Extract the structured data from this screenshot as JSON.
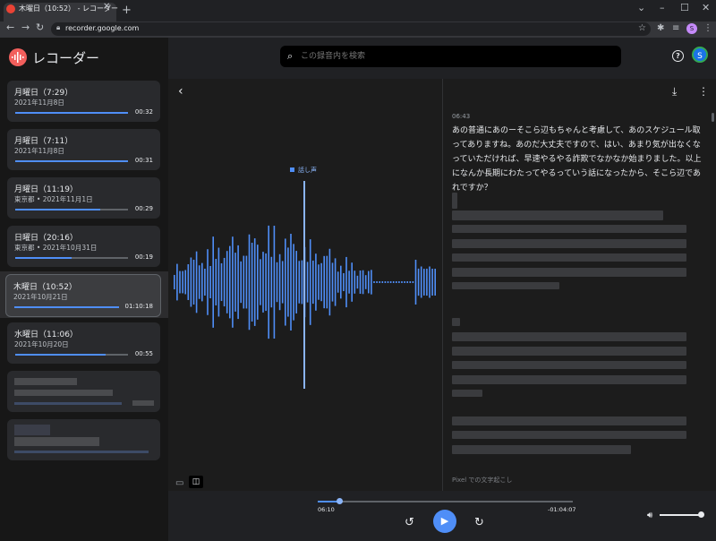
{
  "browser": {
    "tab_title": "木曜日（10:52） - レコーダー",
    "url": "recorder.google.com",
    "profile_initial": "S"
  },
  "app": {
    "title": "レコーダー",
    "search_placeholder": "この録音内を検索",
    "avatar_initial": "S",
    "accent_color": "#4f8ef7",
    "logo_color": "#f25f5c"
  },
  "recordings": [
    {
      "title": "月曜日（7:29）",
      "subtitle": "2021年11月8日",
      "duration": "00:32",
      "progress": 1.0
    },
    {
      "title": "月曜日（7:11）",
      "subtitle": "2021年11月8日",
      "duration": "00:31",
      "progress": 1.0
    },
    {
      "title": "月曜日（11:19）",
      "subtitle": "東京都 • 2021年11月1日",
      "duration": "00:29",
      "progress": 0.75
    },
    {
      "title": "日曜日（20:16）",
      "subtitle": "東京都 • 2021年10月31日",
      "duration": "00:19",
      "progress": 0.5
    },
    {
      "title": "木曜日（10:52）",
      "subtitle": "2021年10月21日",
      "duration": "01:10:18",
      "progress": 1.0,
      "selected": true
    },
    {
      "title": "水曜日（11:06）",
      "subtitle": "2021年10月20日",
      "duration": "00:55",
      "progress": 0.8
    }
  ],
  "waveform": {
    "marker_label": "話し声"
  },
  "transcript": {
    "timestamp": "06:43",
    "text": "あの普通にあのーそこら辺もちゃんと考慮して、あのスケジュール取ってありますね。あのだ大丈夫ですので、はい、あまり気が出なくなっていただければ、早速やるやる詐欺でなかなか始まりました。以上になんか長期にわたってやるっていう話になったから、そこら辺であれですか？",
    "footer": "Pixel での文字起こし"
  },
  "player": {
    "elapsed": "06:10",
    "remaining": "-01:04:07",
    "progress": 0.088,
    "volume": 0.9
  }
}
